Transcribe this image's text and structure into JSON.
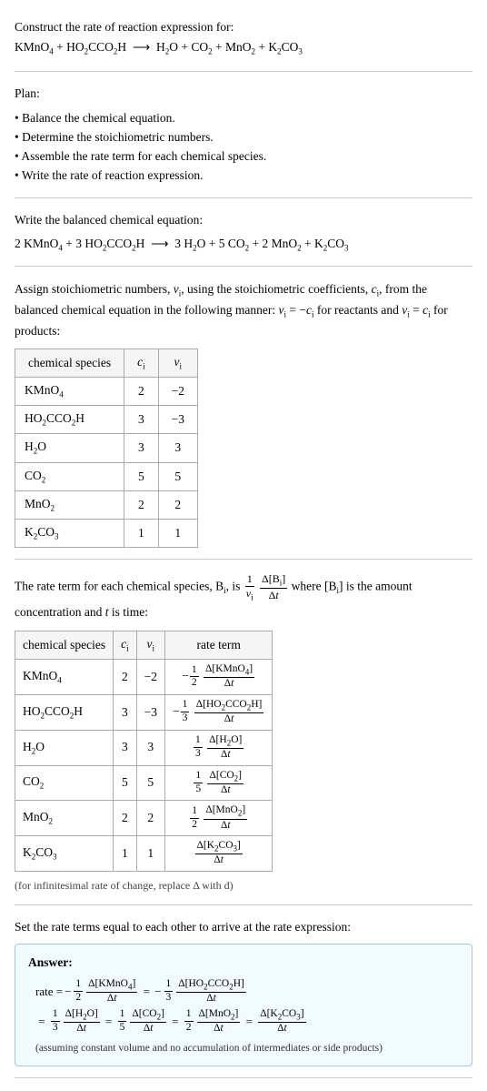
{
  "header": {
    "construct_label": "Construct the rate of reaction expression for:",
    "equation_raw": "KMnO₄ + HO₂CCO₂H ⟶ H₂O + CO₂ + MnO₂ + K₂CO₃"
  },
  "plan": {
    "title": "Plan:",
    "steps": [
      "• Balance the chemical equation.",
      "• Determine the stoichiometric numbers.",
      "• Assemble the rate term for each chemical species.",
      "• Write the rate of reaction expression."
    ]
  },
  "balanced": {
    "label": "Write the balanced chemical equation:",
    "equation": "2 KMnO₄ + 3 HO₂CCO₂H ⟶ 3 H₂O + 5 CO₂ + 2 MnO₂ + K₂CO₃"
  },
  "stoich": {
    "assign_text": "Assign stoichiometric numbers, νᵢ, using the stoichiometric coefficients, cᵢ, from the balanced chemical equation in the following manner: νᵢ = −cᵢ for reactants and νᵢ = cᵢ for products:",
    "table": {
      "headers": [
        "chemical species",
        "cᵢ",
        "νᵢ"
      ],
      "rows": [
        {
          "species": "KMnO₄",
          "ci": "2",
          "vi": "−2"
        },
        {
          "species": "HO₂CCO₂H",
          "ci": "3",
          "vi": "−3"
        },
        {
          "species": "H₂O",
          "ci": "3",
          "vi": "3"
        },
        {
          "species": "CO₂",
          "ci": "5",
          "vi": "5"
        },
        {
          "species": "MnO₂",
          "ci": "2",
          "vi": "2"
        },
        {
          "species": "K₂CO₃",
          "ci": "1",
          "vi": "1"
        }
      ]
    }
  },
  "rate_term": {
    "text_part1": "The rate term for each chemical species, Bᵢ, is",
    "text_frac_num": "1",
    "text_frac_den1": "νᵢ",
    "text_frac_den2": "Δt",
    "text_part2": "where [Bᵢ] is the amount concentration and t is time:",
    "table": {
      "headers": [
        "chemical species",
        "cᵢ",
        "νᵢ",
        "rate term"
      ],
      "rows": [
        {
          "species": "KMnO₄",
          "ci": "2",
          "vi": "−2",
          "rate_num": "Δ[KMnO₄]",
          "rate_coeff": "1/2",
          "rate_sign": "−"
        },
        {
          "species": "HO₂CCO₂H",
          "ci": "3",
          "vi": "−3",
          "rate_num": "Δ[HO₂CCO₂H]",
          "rate_coeff": "1/3",
          "rate_sign": "−"
        },
        {
          "species": "H₂O",
          "ci": "3",
          "vi": "3",
          "rate_num": "Δ[H₂O]",
          "rate_coeff": "1/3",
          "rate_sign": ""
        },
        {
          "species": "CO₂",
          "ci": "5",
          "vi": "5",
          "rate_num": "Δ[CO₂]",
          "rate_coeff": "1/5",
          "rate_sign": ""
        },
        {
          "species": "MnO₂",
          "ci": "2",
          "vi": "2",
          "rate_num": "Δ[MnO₂]",
          "rate_coeff": "1/2",
          "rate_sign": ""
        },
        {
          "species": "K₂CO₃",
          "ci": "1",
          "vi": "1",
          "rate_num": "Δ[K₂CO₃]",
          "rate_coeff": "",
          "rate_sign": ""
        }
      ]
    },
    "note": "(for infinitesimal rate of change, replace Δ with d)"
  },
  "set_rate": {
    "text": "Set the rate terms equal to each other to arrive at the rate expression:"
  },
  "answer": {
    "title": "Answer:",
    "note": "(assuming constant volume and no accumulation of intermediates or side products)"
  },
  "colors": {
    "answer_bg": "#f0faff",
    "answer_border": "#a0c8e0"
  }
}
